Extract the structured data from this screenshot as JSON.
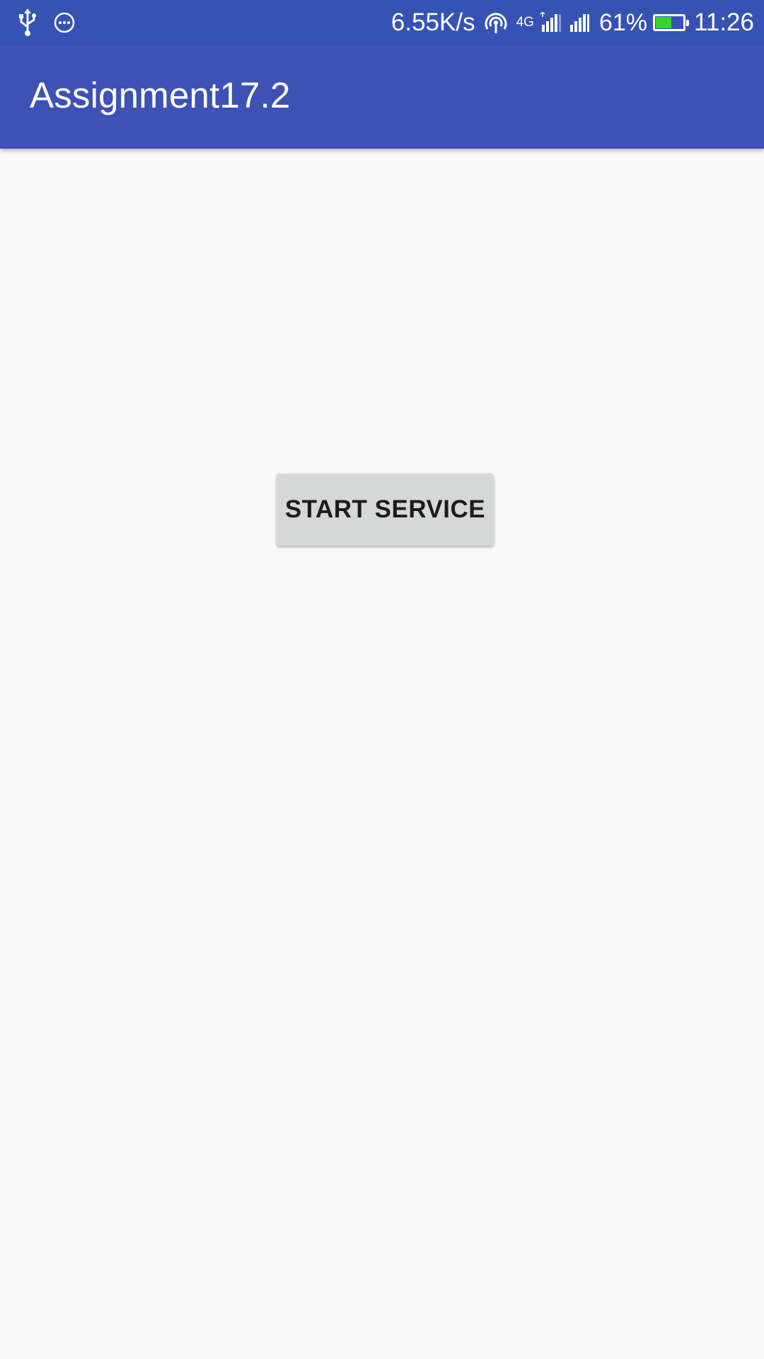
{
  "status_bar": {
    "background": "#3652b4",
    "left_icons": [
      "usb-icon",
      "more-circle-icon"
    ],
    "net_speed": "6.55K/s",
    "network_type": "4G",
    "battery_percent_label": "61%",
    "battery_level": 0.61,
    "battery_color": "#3ad02e",
    "time": "11:26"
  },
  "app_bar": {
    "background": "#3e51b4",
    "title": "Assignment17.2"
  },
  "main": {
    "start_service_label": "START SERVICE"
  }
}
